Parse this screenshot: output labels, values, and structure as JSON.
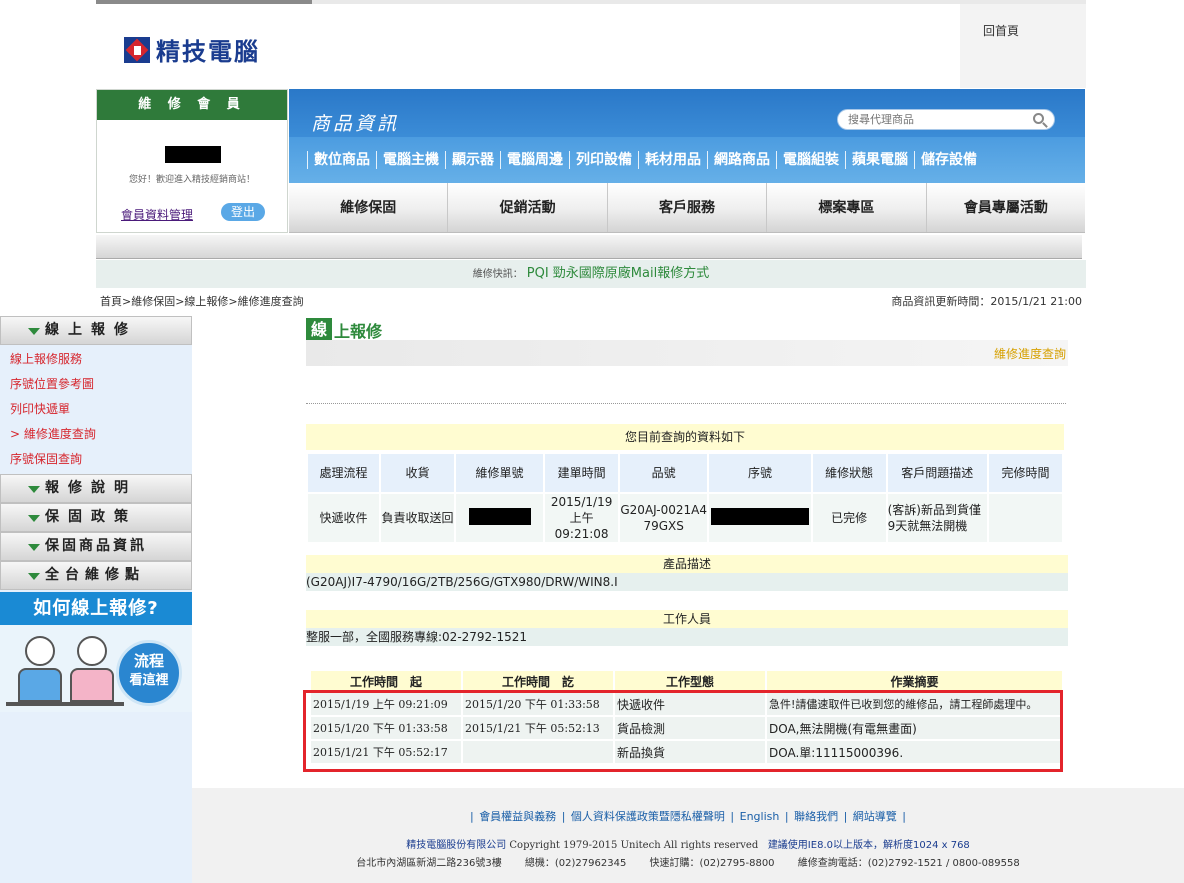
{
  "header": {
    "home_link": "回首頁",
    "logo_text": "精技電腦"
  },
  "member": {
    "title": "維 修 會 員",
    "welcome": "您好！歡迎進入精技經銷商站！",
    "manage_link": "會員資料管理",
    "logout": "登出"
  },
  "product_nav": {
    "title": "商品資訊",
    "search_placeholder": "搜尋代理商品",
    "categories": [
      "數位商品",
      "電腦主機",
      "顯示器",
      "電腦周邊",
      "列印設備",
      "耗材用品",
      "網路商品",
      "電腦組裝",
      "蘋果電腦",
      "儲存設備"
    ]
  },
  "main_nav": [
    "維修保固",
    "促銷活動",
    "客戶服務",
    "標案專區",
    "會員專屬活動"
  ],
  "news": {
    "label": "維修快訊：",
    "text": "PQI 勁永國際原廠Mail報修方式"
  },
  "breadcrumb": "首頁>維修保固>線上報修>維修進度查詢",
  "update_time": "商品資訊更新時間：2015/1/21 21:00",
  "sidebar": {
    "section1": {
      "title": "線上報修",
      "links": [
        "線上報修服務",
        "序號位置參考圖",
        "列印快遞單",
        "> 維修進度查詢",
        "序號保固查詢"
      ]
    },
    "sections": [
      "報修說明",
      "保固政策",
      "保固商品資訊",
      "全台維修點"
    ],
    "help": {
      "title": "如何線上報修?",
      "badge_line1": "流程",
      "badge_line2": "看這裡"
    }
  },
  "content": {
    "title_badge": "線",
    "title_rest": "上報修",
    "band_link": "維修進度查詢",
    "query_title": "您目前查詢的資料如下",
    "query_headers": [
      "處理流程",
      "收貨",
      "維修單號",
      "建單時間",
      "品號",
      "序號",
      "維修狀態",
      "客戶問題描述",
      "完修時間"
    ],
    "query_row": {
      "flow": "快遞收件",
      "receive": "負責收取送回",
      "created": "2015/1/19 上午 09:21:08",
      "part_no": "G20AJ-0021A479GXS",
      "status": "已完修",
      "problem": "(客訴)新品到貨僅9天就無法開機",
      "finished": ""
    },
    "product_desc_head": "產品描述",
    "product_desc": "(G20AJ)I7-4790/16G/2TB/256G/GTX980/DRW/WIN8.I",
    "staff_head": "工作人員",
    "staff": "整服一部，全國服務專線:02-2792-1521",
    "work_headers": [
      "工作時間　起",
      "工作時間　訖",
      "工作型態",
      "作業摘要"
    ],
    "work_rows": [
      {
        "start": "2015/1/19 上午 09:21:09",
        "end": "2015/1/20 下午 01:33:58",
        "type": "快遞收件",
        "summary": "急件!請儘速取件已收到您的維修品，請工程師處理中。"
      },
      {
        "start": "2015/1/20 下午 01:33:58",
        "end": "2015/1/21 下午 05:52:13",
        "type": "貨品檢測",
        "summary": "DOA,無法開機(有電無畫面)"
      },
      {
        "start": "2015/1/21 下午 05:52:17",
        "end": "",
        "type": "新品換貨",
        "summary": "DOA.單:11115000396."
      }
    ]
  },
  "footer": {
    "links": [
      "會員權益與義務",
      "個人資料保護政策暨隱私權聲明",
      "English",
      "聯絡我們",
      "網站導覽"
    ],
    "company": "精技電腦股份有限公司",
    "copyright": "Copyright 1979-2015 Unitech All rights reserved",
    "browser_note": "建議使用IE8.0以上版本，解析度1024 x 768",
    "address": "台北市內湖區新湖二路236號3樓",
    "phone": "總機：(02)27962345",
    "order_phone": "快速訂購：(02)2795-8800",
    "repair_phone": "維修查詢電話：(02)2792-1521 / 0800-089558"
  }
}
